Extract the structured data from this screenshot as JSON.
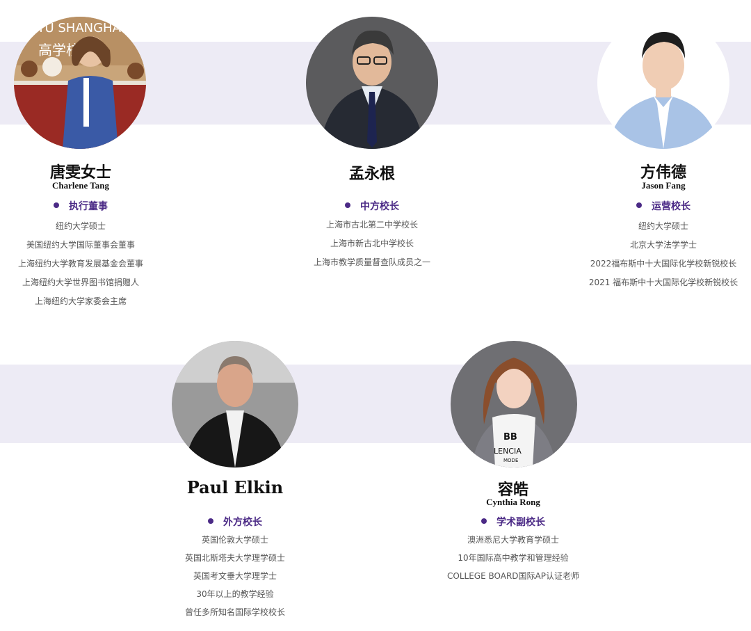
{
  "colors": {
    "band": "#edebf5",
    "accent": "#4b2a86"
  },
  "people": [
    {
      "name": "唐雯女士",
      "english_name": "Charlene Tang",
      "role": "执行董事",
      "credentials": [
        "纽约大学硕士",
        "美国纽约大学国际董事会董事",
        "上海纽约大学教育发展基金会董事",
        "上海纽约大学世界图书馆捐赠人",
        "上海纽约大学家委会主席"
      ],
      "photo_sign_text": [
        "NYU SHANGHAI",
        "高学校"
      ]
    },
    {
      "name": "孟永根",
      "english_name": "",
      "role": "中方校长",
      "credentials": [
        "上海市古北第二中学校长",
        "上海市新古北中学校长",
        "上海市教学质量督查队成员之一"
      ]
    },
    {
      "name": "方伟德",
      "english_name": "Jason Fang",
      "role": "运营校长",
      "credentials": [
        "纽约大学硕士",
        "北京大学法学学士",
        "2022福布斯中十大国际化学校新锐校长",
        "2021 福布斯中十大国际化学校新锐校长"
      ]
    },
    {
      "name": "Paul Elkin",
      "english_name": "",
      "role": "外方校长",
      "credentials": [
        "英国伦敦大学硕士",
        "英国北斯塔夫大学理学硕士",
        "英国考文垂大学理学士",
        "30年以上的教学经验",
        "曾任多所知名国际学校校长"
      ]
    },
    {
      "name": "容皓",
      "english_name": "Cynthia Rong",
      "role": "学术副校长",
      "credentials": [
        "澳洲悉尼大学教育学硕士",
        "10年国际高中教学和管理经验",
        "COLLEGE BOARD国际AP认证老师"
      ],
      "photo_shirt_text": [
        "BB",
        "LENCIA",
        "MODE"
      ]
    }
  ]
}
